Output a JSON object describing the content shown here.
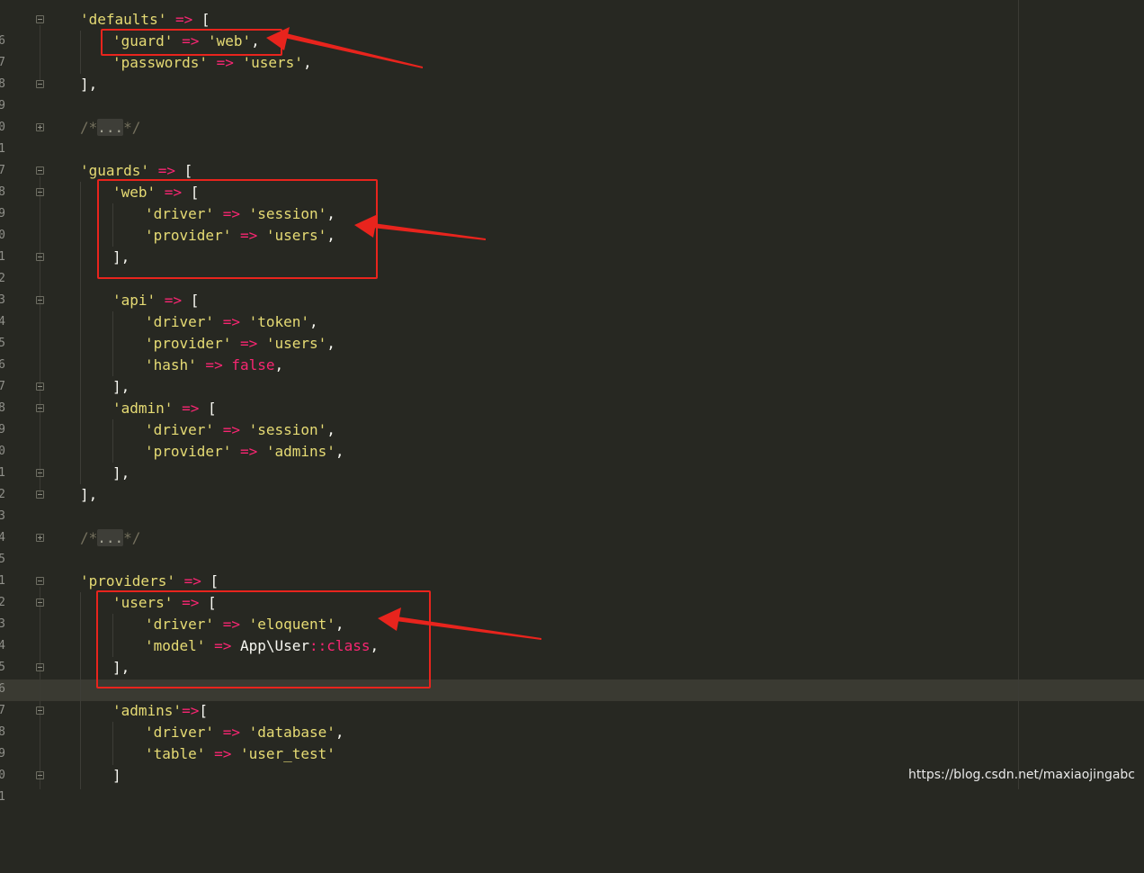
{
  "gutter": {
    "line_numbers": [
      "6",
      "7",
      "8",
      "9",
      "0",
      "1",
      "7",
      "8",
      "9",
      "0",
      "1",
      "2",
      "3",
      "4",
      "5",
      "6",
      "7",
      "8",
      "9",
      "0",
      "1",
      "2",
      "3",
      "4",
      "5",
      "1",
      "2",
      "3",
      "4",
      "5",
      "6",
      "7",
      "8",
      "9",
      "0",
      "1"
    ]
  },
  "code": {
    "l01": {
      "k": "'defaults'",
      "op": " => ",
      "br": "["
    },
    "l02": {
      "k": "'guard'",
      "op": " => ",
      "v": "'web'",
      "end": ","
    },
    "l03": {
      "k": "'passwords'",
      "op": " => ",
      "v": "'users'",
      "end": ","
    },
    "l04": {
      "t": "],"
    },
    "l06": {
      "open": "/*",
      "dots": "...",
      "close": "*/"
    },
    "l08": {
      "k": "'guards'",
      "op": " => ",
      "br": "["
    },
    "l09": {
      "k": "'web'",
      "op": " => ",
      "br": "["
    },
    "l10": {
      "k": "'driver'",
      "op": " => ",
      "v": "'session'",
      "end": ","
    },
    "l11": {
      "k": "'provider'",
      "op": " => ",
      "v": "'users'",
      "end": ","
    },
    "l12": {
      "t": "],"
    },
    "l14": {
      "k": "'api'",
      "op": " => ",
      "br": "["
    },
    "l15": {
      "k": "'driver'",
      "op": " => ",
      "v": "'token'",
      "end": ","
    },
    "l16": {
      "k": "'provider'",
      "op": " => ",
      "v": "'users'",
      "end": ","
    },
    "l17": {
      "k": "'hash'",
      "op": " => ",
      "kw": "false",
      "end": ","
    },
    "l18": {
      "t": "],"
    },
    "l19": {
      "k": "'admin'",
      "op": " => ",
      "br": "["
    },
    "l20": {
      "k": "'driver'",
      "op": " => ",
      "v": "'session'",
      "end": ","
    },
    "l21": {
      "k": "'provider'",
      "op": " => ",
      "v": "'admins'",
      "end": ","
    },
    "l22": {
      "t": "],"
    },
    "l23": {
      "t": "],"
    },
    "l25": {
      "open": "/*",
      "dots": "...",
      "close": "*/"
    },
    "l27": {
      "k": "'providers'",
      "op": " => ",
      "br": "["
    },
    "l28": {
      "k": "'users'",
      "op": " => ",
      "br": "["
    },
    "l29": {
      "k": "'driver'",
      "op": " => ",
      "v": "'eloquent'",
      "end": ","
    },
    "l30": {
      "k": "'model'",
      "op": " => ",
      "cls": "App\\User",
      "dc": "::",
      "ck": "class",
      "end": ","
    },
    "l31": {
      "t": "],"
    },
    "l33": {
      "k": "'admins'",
      "op": "=>",
      "br": "["
    },
    "l34": {
      "k": "'driver'",
      "op": " => ",
      "v": "'database'",
      "end": ","
    },
    "l35": {
      "k": "'table'",
      "op": " => ",
      "v": "'user_test'"
    },
    "l36": {
      "t": "]"
    }
  },
  "colors": {
    "background": "#272822",
    "string": "#e6db74",
    "operator": "#f92672",
    "annotation": "#e8241d"
  },
  "watermark": "https://blog.csdn.net/maxiaojingabc"
}
